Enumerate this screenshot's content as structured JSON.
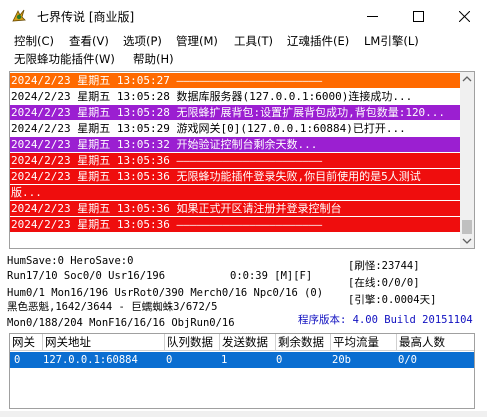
{
  "window": {
    "title": "七界传说 [商业版]"
  },
  "menu": {
    "row1": [
      "控制(C)",
      "查看(V)",
      "选项(P)",
      "管理(M)",
      "工具(T)",
      "辽魂插件(E)",
      "LM引擎(L)"
    ],
    "row2": [
      "无限蜂功能插件(W)",
      "帮助(H)"
    ]
  },
  "log": {
    "lines": [
      {
        "text": "2024/2/23 星期五 13:05:27 ——————————————————————",
        "color": "orange"
      },
      {
        "text": "2024/2/23 星期五 13:05:28 数据库服务器(127.0.0.1:6000)连接成功...",
        "color": "plain"
      },
      {
        "text": "2024/2/23 星期五 13:05:28 无限蜂扩展背包:设置扩展背包成功,背包数量:120...",
        "color": "purple"
      },
      {
        "text": "2024/2/23 星期五 13:05:29 游戏网关[0](127.0.0.1:60884)已打开...",
        "color": "plain"
      },
      {
        "text": "2024/2/23 星期五 13:05:32 开始验证控制台剩余天数...",
        "color": "purple"
      },
      {
        "text": "2024/2/23 星期五 13:05:36 ——————————————————————",
        "color": "red"
      },
      {
        "text": "2024/2/23 星期五 13:05:36 无限蜂功能插件登录失败,你目前使用的是5人测试",
        "color": "red"
      },
      {
        "text": "版...",
        "color": "red"
      },
      {
        "text": "2024/2/23 星期五 13:05:36 如果正式开区请注册并登录控制台",
        "color": "red"
      },
      {
        "text": "2024/2/23 星期五 13:05:36 ——————————————————————",
        "color": "red"
      }
    ]
  },
  "stats": {
    "line1": "HumSave:0 HeroSave:0",
    "line2": "Run17/10 Soc0/0 Usr16/196",
    "line2b": "0:0:39 [M][F]",
    "line3": "Hum0/1 Mon16/196 UsrRot0/390 Merch0/16 Npc0/16 (0)",
    "line4": "黑色恶魁,1642/3644 - 巨蠕蜘蛛3/672/5",
    "line5": "Mon0/188/204 MonF16/16/16 ObjRun0/16",
    "refresh": "[刷怪:23744]",
    "online": "[在线:0/0/0]",
    "rate": "[引擎:0.0004天]",
    "version": "程序版本: 4.00 Build 20151104"
  },
  "gateway": {
    "headers": [
      "网关",
      "网关地址",
      "队列数据",
      "发送数据",
      "剩余数据",
      "平均流量",
      "最高人数"
    ],
    "rows": [
      [
        "0",
        "127.0.0.1:60884",
        "0",
        "1",
        "0",
        "20b",
        "0/0"
      ]
    ]
  },
  "colors": {
    "orange": "#ff6a00",
    "purple": "#9b1fd1",
    "red": "#ef0d0d",
    "selection": "#0a6ed1",
    "version_text": "#1010c0"
  },
  "icons": [
    "app-icon",
    "minimize-icon",
    "maximize-icon",
    "close-icon",
    "scroll-up-icon",
    "scroll-down-icon"
  ]
}
